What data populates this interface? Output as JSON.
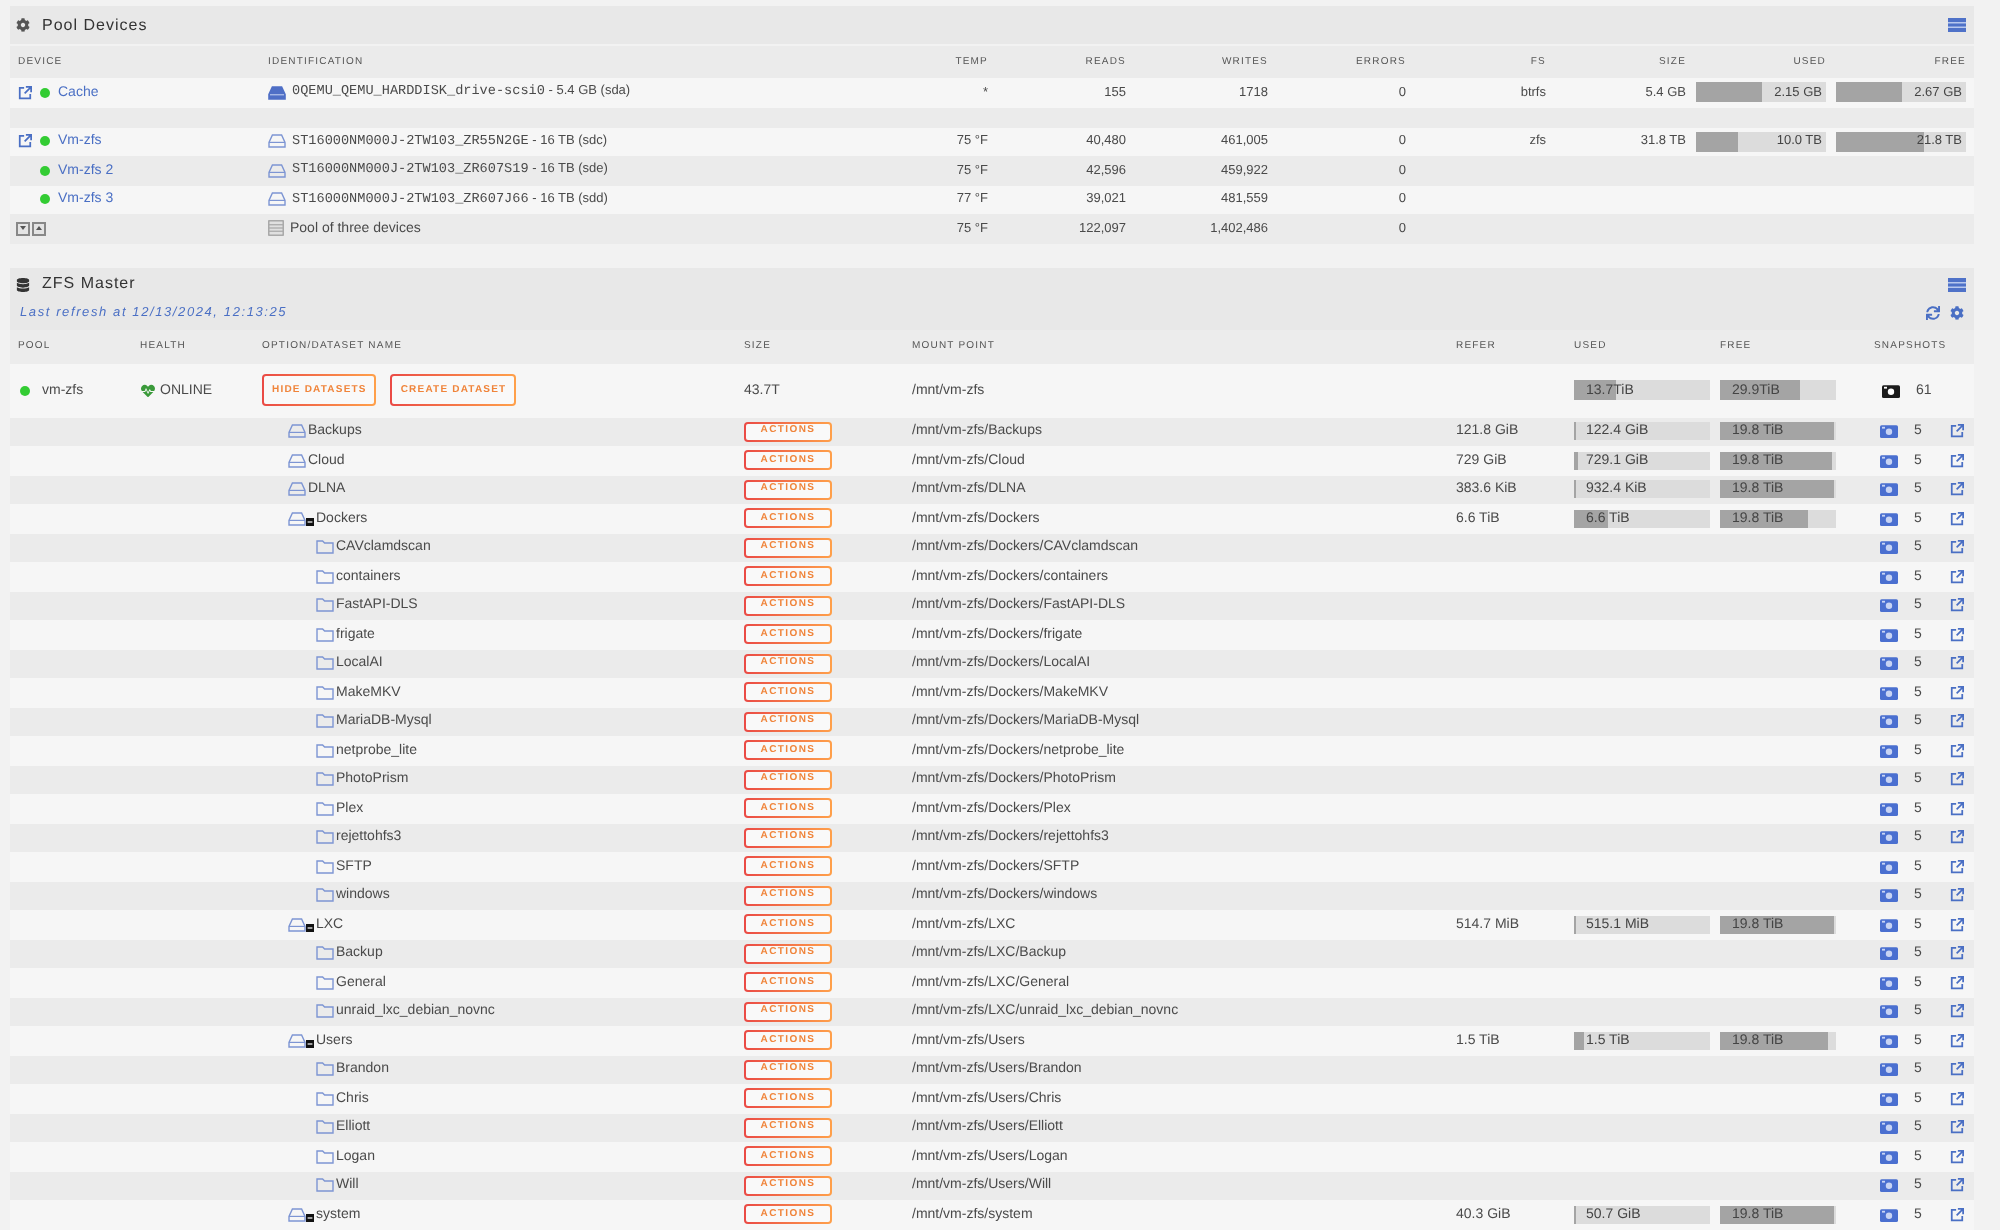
{
  "pool_devices": {
    "title": "Pool Devices",
    "columns": [
      "DEVICE",
      "IDENTIFICATION",
      "TEMP",
      "READS",
      "WRITES",
      "ERRORS",
      "FS",
      "SIZE",
      "USED",
      "FREE"
    ],
    "rows": [
      {
        "kind": "device",
        "link": true,
        "color": "#33cc33",
        "name": "Cache",
        "drive_filled": true,
        "id_name": "0QEMU_QEMU_HARDDISK_drive-scsi0",
        "id_detail": "- 5.4 GB (sda)",
        "temp": "*",
        "reads": "155",
        "writes": "1718",
        "errors": "0",
        "fs": "btrfs",
        "size": "5.4 GB",
        "used": {
          "text": "2.15 GB",
          "level": 0.5
        },
        "free": {
          "text": "2.67 GB",
          "level": 0.5
        }
      },
      {
        "kind": "separator"
      },
      {
        "kind": "device",
        "link": true,
        "color": "#33cc33",
        "name": "Vm-zfs",
        "drive_filled": false,
        "id_name": "ST16000NM000J-2TW103_ZR55N2GE",
        "id_detail": "- 16 TB (sdc)",
        "temp": "75 °F",
        "reads": "40,480",
        "writes": "461,005",
        "errors": "0",
        "fs": "zfs",
        "size": "31.8 TB",
        "used": {
          "text": "10.0 TB",
          "level": 0.32
        },
        "free": {
          "text": "21.8 TB",
          "level": 0.68
        }
      },
      {
        "kind": "device",
        "link": false,
        "color": "#33cc33",
        "name": "Vm-zfs 2",
        "drive_filled": false,
        "id_name": "ST16000NM000J-2TW103_ZR607S19",
        "id_detail": "- 16 TB (sde)",
        "temp": "75 °F",
        "reads": "42,596",
        "writes": "459,922",
        "errors": "0"
      },
      {
        "kind": "device",
        "link": false,
        "color": "#33cc33",
        "name": "Vm-zfs 3",
        "drive_filled": false,
        "id_name": "ST16000NM000J-2TW103_ZR607J66",
        "id_detail": "- 16 TB (sdd)",
        "temp": "77 °F",
        "reads": "39,021",
        "writes": "481,559",
        "errors": "0"
      },
      {
        "kind": "summary",
        "label": "Pool of three devices",
        "temp": "75 °F",
        "reads": "122,097",
        "writes": "1,402,486",
        "errors": "0"
      }
    ]
  },
  "zfs_master": {
    "title": "ZFS Master",
    "last_refresh": "Last refresh at 12/13/2024, 12:13:25",
    "columns": [
      "POOL",
      "HEALTH",
      "OPTION/DATASET NAME",
      "SIZE",
      "MOUNT POINT",
      "REFER",
      "USED",
      "FREE",
      "SNAPSHOTS"
    ],
    "pool": {
      "name": "vm-zfs",
      "color": "#33cc33",
      "health": "ONLINE",
      "buttons": [
        "HIDE DATASETS",
        "CREATE DATASET"
      ],
      "size": "43.7T",
      "mount": "/mnt/vm-zfs",
      "used": {
        "text": "13.7TiB",
        "level": 0.31
      },
      "free": {
        "text": "29.9TiB",
        "level": 0.69
      },
      "snapshots": "61"
    },
    "datasets": [
      {
        "name": "Backups",
        "action": "ACTIONS",
        "mount": "/mnt/vm-zfs/Backups",
        "refer": "121.8 GiB",
        "used": {
          "text": "122.4 GiB",
          "level": 0.015
        },
        "free": {
          "text": "19.8 TiB",
          "level": 0.98
        },
        "snapshots": "5"
      },
      {
        "name": "Cloud",
        "action": "ACTIONS",
        "mount": "/mnt/vm-zfs/Cloud",
        "refer": "729 GiB",
        "used": {
          "text": "729.1 GiB",
          "level": 0.03
        },
        "free": {
          "text": "19.8 TiB",
          "level": 0.97
        },
        "snapshots": "5"
      },
      {
        "name": "DLNA",
        "action": "ACTIONS",
        "mount": "/mnt/vm-zfs/DLNA",
        "refer": "383.6 KiB",
        "used": {
          "text": "932.4 KiB",
          "level": 0
        },
        "free": {
          "text": "19.8 TiB",
          "level": 0.98
        },
        "snapshots": "5"
      },
      {
        "name": "Dockers",
        "expanded": true,
        "action": "ACTIONS",
        "mount": "/mnt/vm-zfs/Dockers",
        "refer": "6.6 TiB",
        "used": {
          "text": "6.6 TiB",
          "level": 0.25
        },
        "free": {
          "text": "19.8 TiB",
          "level": 0.76
        },
        "snapshots": "5",
        "children": [
          {
            "name": "CAVclamdscan",
            "action": "ACTIONS",
            "mount": "/mnt/vm-zfs/Dockers/CAVclamdscan",
            "snapshots": "5"
          },
          {
            "name": "containers",
            "action": "ACTIONS",
            "mount": "/mnt/vm-zfs/Dockers/containers",
            "snapshots": "5"
          },
          {
            "name": "FastAPI-DLS",
            "action": "ACTIONS",
            "mount": "/mnt/vm-zfs/Dockers/FastAPI-DLS",
            "snapshots": "5"
          },
          {
            "name": "frigate",
            "action": "ACTIONS",
            "mount": "/mnt/vm-zfs/Dockers/frigate",
            "snapshots": "5"
          },
          {
            "name": "LocalAI",
            "action": "ACTIONS",
            "mount": "/mnt/vm-zfs/Dockers/LocalAI",
            "snapshots": "5"
          },
          {
            "name": "MakeMKV",
            "action": "ACTIONS",
            "mount": "/mnt/vm-zfs/Dockers/MakeMKV",
            "snapshots": "5"
          },
          {
            "name": "MariaDB-Mysql",
            "action": "ACTIONS",
            "mount": "/mnt/vm-zfs/Dockers/MariaDB-Mysql",
            "snapshots": "5"
          },
          {
            "name": "netprobe_lite",
            "action": "ACTIONS",
            "mount": "/mnt/vm-zfs/Dockers/netprobe_lite",
            "snapshots": "5"
          },
          {
            "name": "PhotoPrism",
            "action": "ACTIONS",
            "mount": "/mnt/vm-zfs/Dockers/PhotoPrism",
            "snapshots": "5"
          },
          {
            "name": "Plex",
            "action": "ACTIONS",
            "mount": "/mnt/vm-zfs/Dockers/Plex",
            "snapshots": "5"
          },
          {
            "name": "rejettohfs3",
            "action": "ACTIONS",
            "mount": "/mnt/vm-zfs/Dockers/rejettohfs3",
            "snapshots": "5"
          },
          {
            "name": "SFTP",
            "action": "ACTIONS",
            "mount": "/mnt/vm-zfs/Dockers/SFTP",
            "snapshots": "5"
          },
          {
            "name": "windows",
            "action": "ACTIONS",
            "mount": "/mnt/vm-zfs/Dockers/windows",
            "snapshots": "5"
          }
        ]
      },
      {
        "name": "LXC",
        "expanded": true,
        "action": "ACTIONS",
        "mount": "/mnt/vm-zfs/LXC",
        "refer": "514.7 MiB",
        "used": {
          "text": "515.1 MiB",
          "level": 0
        },
        "free": {
          "text": "19.8 TiB",
          "level": 0.98
        },
        "snapshots": "5",
        "children": [
          {
            "name": "Backup",
            "action": "ACTIONS",
            "mount": "/mnt/vm-zfs/LXC/Backup",
            "snapshots": "5"
          },
          {
            "name": "General",
            "action": "ACTIONS",
            "mount": "/mnt/vm-zfs/LXC/General",
            "snapshots": "5"
          },
          {
            "name": "unraid_lxc_debian_novnc",
            "action": "ACTIONS",
            "mount": "/mnt/vm-zfs/LXC/unraid_lxc_debian_novnc",
            "snapshots": "5"
          }
        ]
      },
      {
        "name": "Users",
        "expanded": true,
        "action": "ACTIONS",
        "mount": "/mnt/vm-zfs/Users",
        "refer": "1.5 TiB",
        "used": {
          "text": "1.5 TiB",
          "level": 0.07
        },
        "free": {
          "text": "19.8 TiB",
          "level": 0.93
        },
        "snapshots": "5",
        "children": [
          {
            "name": "Brandon",
            "action": "ACTIONS",
            "mount": "/mnt/vm-zfs/Users/Brandon",
            "snapshots": "5"
          },
          {
            "name": "Chris",
            "action": "ACTIONS",
            "mount": "/mnt/vm-zfs/Users/Chris",
            "snapshots": "5"
          },
          {
            "name": "Elliott",
            "action": "ACTIONS",
            "mount": "/mnt/vm-zfs/Users/Elliott",
            "snapshots": "5"
          },
          {
            "name": "Logan",
            "action": "ACTIONS",
            "mount": "/mnt/vm-zfs/Users/Logan",
            "snapshots": "5"
          },
          {
            "name": "Will",
            "action": "ACTIONS",
            "mount": "/mnt/vm-zfs/Users/Will",
            "snapshots": "5"
          }
        ]
      },
      {
        "name": "system",
        "expanded": true,
        "action": "ACTIONS",
        "mount": "/mnt/vm-zfs/system",
        "refer": "40.3 GiB",
        "used": {
          "text": "50.7 GiB",
          "level": 0
        },
        "free": {
          "text": "19.8 TiB",
          "level": 0.98
        },
        "snapshots": "5"
      }
    ]
  }
}
